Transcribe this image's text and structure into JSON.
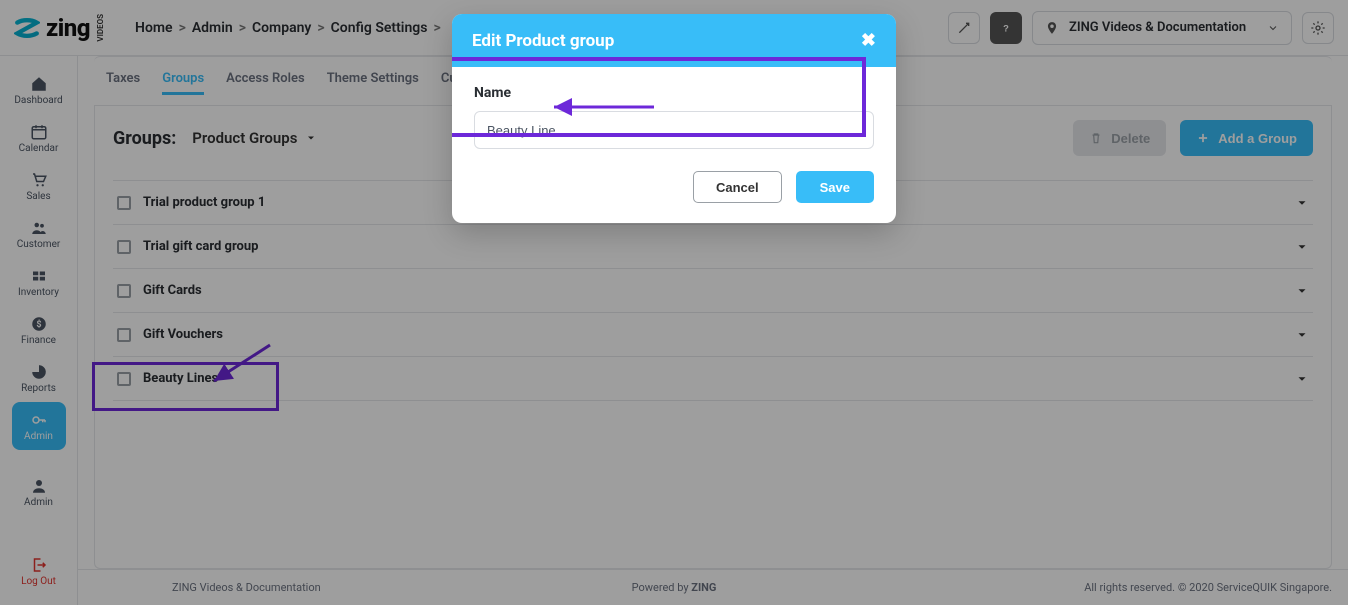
{
  "header": {
    "brand": "zing",
    "brand_sub": "VIDEOS",
    "breadcrumbs": [
      "Home",
      "Admin",
      "Company",
      "Config Settings"
    ],
    "location": "ZING Videos & Documentation"
  },
  "sidebar": {
    "items": [
      {
        "label": "Dashboard"
      },
      {
        "label": "Calendar"
      },
      {
        "label": "Sales"
      },
      {
        "label": "Customer"
      },
      {
        "label": "Inventory"
      },
      {
        "label": "Finance"
      },
      {
        "label": "Reports"
      },
      {
        "label": "Admin"
      },
      {
        "label": "Admin"
      }
    ],
    "logout": "Log Out"
  },
  "tabs": {
    "items": [
      "Taxes",
      "Groups",
      "Access Roles",
      "Theme Settings",
      "Cu"
    ],
    "active_index": 1
  },
  "content": {
    "heading": "Groups:",
    "dropdown": "Product Groups",
    "delete_label": "Delete",
    "add_label": "Add a Group",
    "groups": [
      {
        "name": "Trial product group 1"
      },
      {
        "name": "Trial gift card group"
      },
      {
        "name": "Gift Cards"
      },
      {
        "name": "Gift Vouchers"
      },
      {
        "name": "Beauty Lines"
      }
    ]
  },
  "footer": {
    "left": "ZING Videos & Documentation",
    "center_prefix": "Powered by ",
    "center_brand": "ZING",
    "right": "All rights reserved. © 2020 ServiceQUIK Singapore."
  },
  "modal": {
    "title": "Edit Product group",
    "name_label": "Name",
    "name_value": "Beauty Line",
    "cancel": "Cancel",
    "save": "Save"
  }
}
